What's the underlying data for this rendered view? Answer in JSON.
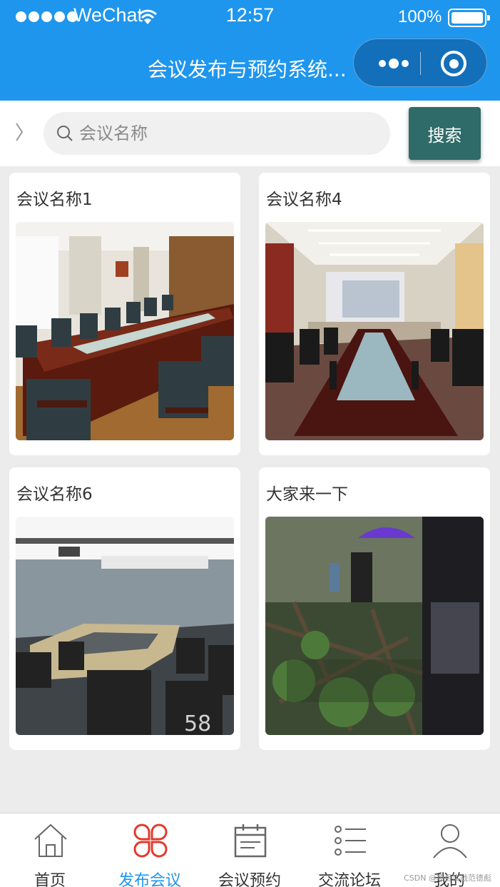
{
  "status_bar": {
    "carrier": "WeChat",
    "time": "12:57",
    "battery": "100%"
  },
  "nav": {
    "title": "会议发布与预约系统..."
  },
  "search": {
    "placeholder": "会议名称",
    "button_label": "搜索"
  },
  "meetings": [
    {
      "title": "会议名称1",
      "image": "conference-room-photo"
    },
    {
      "title": "会议名称4",
      "image": "conference-room-photo"
    },
    {
      "title": "会议名称6",
      "image": "conference-room-photo"
    },
    {
      "title": "大家来一下",
      "image": "jungle-adventure-photo"
    }
  ],
  "tabbar": {
    "items": [
      {
        "label": "首页",
        "icon": "home-icon",
        "active": false
      },
      {
        "label": "发布会议",
        "icon": "clover-icon",
        "active": true
      },
      {
        "label": "会议预约",
        "icon": "calendar-icon",
        "active": false
      },
      {
        "label": "交流论坛",
        "icon": "list-icon",
        "active": false
      },
      {
        "label": "我的",
        "icon": "user-icon",
        "active": false
      }
    ]
  },
  "watermark": "CSDN @项目实战范德彪",
  "colors": {
    "header": "#1e96ee",
    "search_button": "#2f6b68",
    "active_tab": "#1e96ee",
    "page_bg": "#ececec"
  }
}
